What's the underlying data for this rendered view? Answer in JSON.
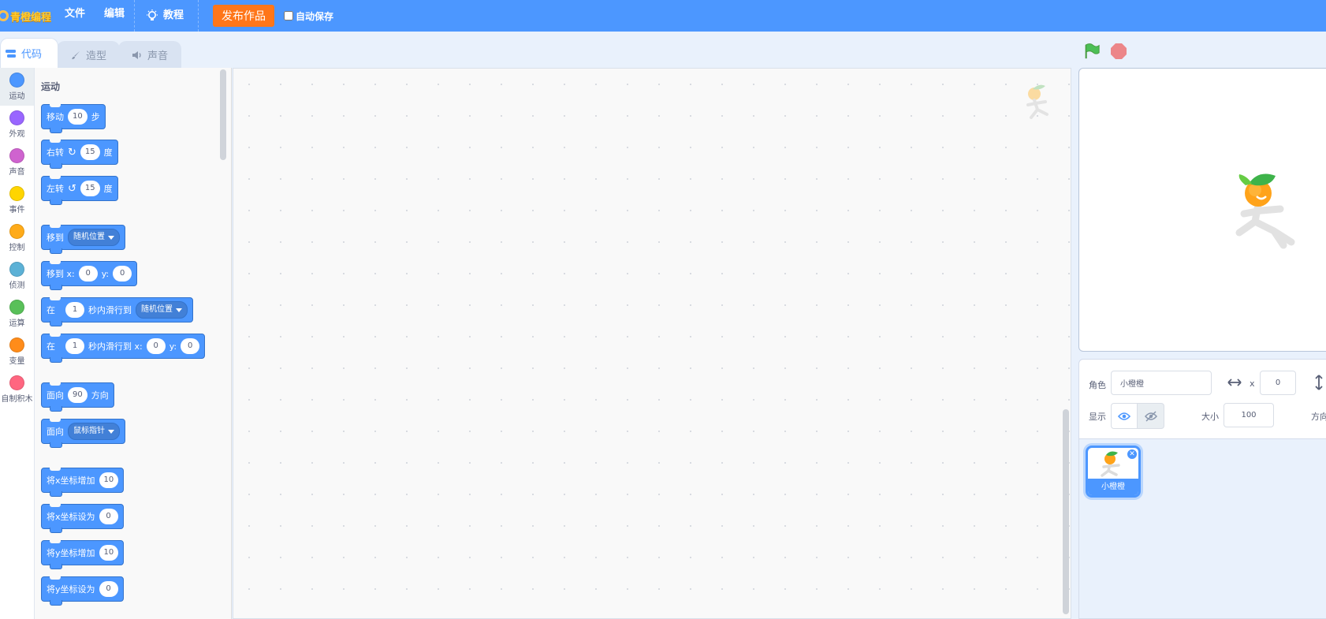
{
  "menubar": {
    "logo_text": "青橙编程",
    "file": "文件",
    "edit": "编辑",
    "tutorial": "教程",
    "publish": "发布作品",
    "autosave": "自动保存"
  },
  "tabs": {
    "code": "代码",
    "costume": "造型",
    "sound": "声音"
  },
  "categories": [
    {
      "label": "运动",
      "color": "#4c97ff"
    },
    {
      "label": "外观",
      "color": "#9966ff"
    },
    {
      "label": "声音",
      "color": "#cf63cf"
    },
    {
      "label": "事件",
      "color": "#ffd500"
    },
    {
      "label": "控制",
      "color": "#ffab19"
    },
    {
      "label": "侦测",
      "color": "#5cb1d6"
    },
    {
      "label": "运算",
      "color": "#59c059"
    },
    {
      "label": "变量",
      "color": "#ff8c1a"
    },
    {
      "label": "自制积木",
      "color": "#ff6680"
    }
  ],
  "palette": {
    "title": "运动",
    "move": {
      "label": "移动",
      "value": "10",
      "unit": "步"
    },
    "turn_right": {
      "label": "右转",
      "value": "15",
      "unit": "度"
    },
    "turn_left": {
      "label": "左转",
      "value": "15",
      "unit": "度"
    },
    "goto": {
      "label": "移到",
      "option": "随机位置"
    },
    "goto_xy": {
      "label": "移到 x:",
      "x": "0",
      "ylabel": "y:",
      "y": "0"
    },
    "glide": {
      "prefix": "在",
      "secs": "1",
      "mid": "秒内滑行到",
      "option": "随机位置"
    },
    "glide_xy": {
      "prefix": "在",
      "secs": "1",
      "mid": "秒内滑行到 x:",
      "x": "0",
      "ylabel": "y:",
      "y": "0"
    },
    "point_dir": {
      "label": "面向",
      "value": "90",
      "unit": "方向"
    },
    "point_towards": {
      "label": "面向",
      "option": "鼠标指针"
    },
    "change_x": {
      "label": "将x坐标增加",
      "value": "10"
    },
    "set_x": {
      "label": "将x坐标设为",
      "value": "0"
    },
    "change_y": {
      "label": "将y坐标增加",
      "value": "10"
    },
    "set_y": {
      "label": "将y坐标设为",
      "value": "0"
    }
  },
  "sprite_info": {
    "sprite_label": "角色",
    "sprite_name": "小橙橙",
    "x_label": "x",
    "x_value": "0",
    "show_label": "显示",
    "size_label": "大小",
    "size_value": "100",
    "direction_label": "方向"
  },
  "sprite_list": {
    "items": [
      {
        "name": "小橙橙"
      }
    ]
  },
  "colors": {
    "menubar": "#4c97ff",
    "motion": "#4c97ff",
    "publish": "#ff7619"
  }
}
